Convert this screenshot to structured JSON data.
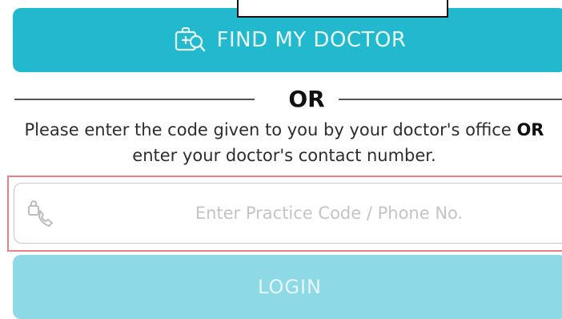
{
  "find_doctor": {
    "label": "FIND MY DOCTOR",
    "icon": "doctor-bag-search-icon"
  },
  "divider": {
    "label": "OR"
  },
  "instructions": {
    "part1": "Please enter the code given to you by your doctor's office ",
    "emphasis": "OR",
    "part2": " enter your doctor's contact number."
  },
  "code_field": {
    "placeholder": "Enter Practice Code / Phone No.",
    "value": "",
    "icon": "lock-phone-icon"
  },
  "login": {
    "label": "LOGIN"
  },
  "colors": {
    "accent": "#22b9cf",
    "login_disabled": "#8dd9e6",
    "highlight": "#ef7f86"
  }
}
